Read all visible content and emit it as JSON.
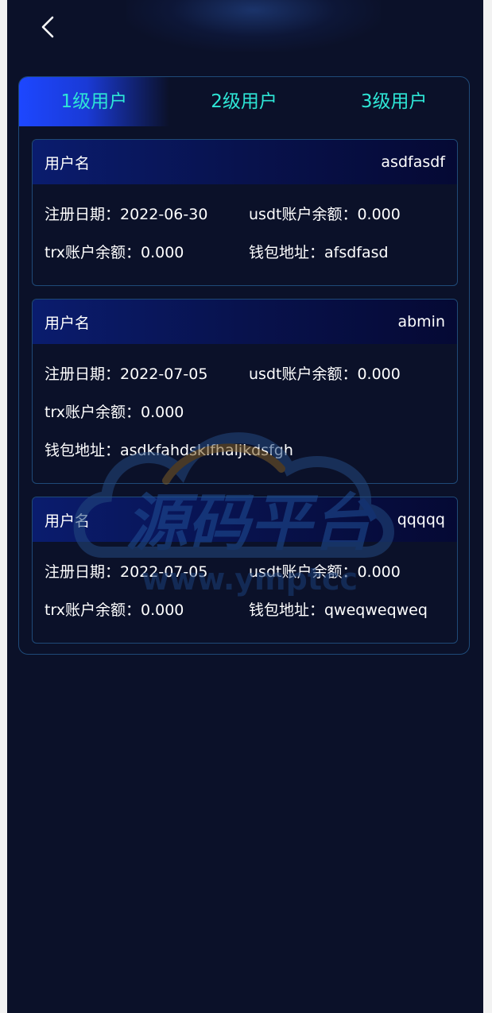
{
  "tabs": [
    {
      "label": "1级用户"
    },
    {
      "label": "2级用户"
    },
    {
      "label": "3级用户"
    }
  ],
  "cards": [
    {
      "username_label": "用户名",
      "username": "asdfasdf",
      "reg_date": "注册日期：2022-06-30",
      "usdt": "usdt账户余额：0.000",
      "trx": "trx账户余额：0.000",
      "wallet": "钱包地址：afsdfasd"
    },
    {
      "username_label": "用户名",
      "username": "abmin",
      "reg_date": "注册日期：2022-07-05",
      "usdt": "usdt账户余额：0.000",
      "trx": "trx账户余额：0.000",
      "wallet": "钱包地址：asdkfahdsklfhaljkdsfgh"
    },
    {
      "username_label": "用户名",
      "username": "qqqqq",
      "reg_date": "注册日期：2022-07-05",
      "usdt": "usdt账户余额：0.000",
      "trx": "trx账户余额：0.000",
      "wallet": "钱包地址：qweqweqweq"
    }
  ],
  "watermark": {
    "title": "源码平台",
    "url": "www.ymptcc"
  },
  "colors": {
    "background": "#0b1129",
    "tab_text": "#2ee6d6",
    "active_tab": "#1d47ff",
    "border": "#1f4a78"
  }
}
